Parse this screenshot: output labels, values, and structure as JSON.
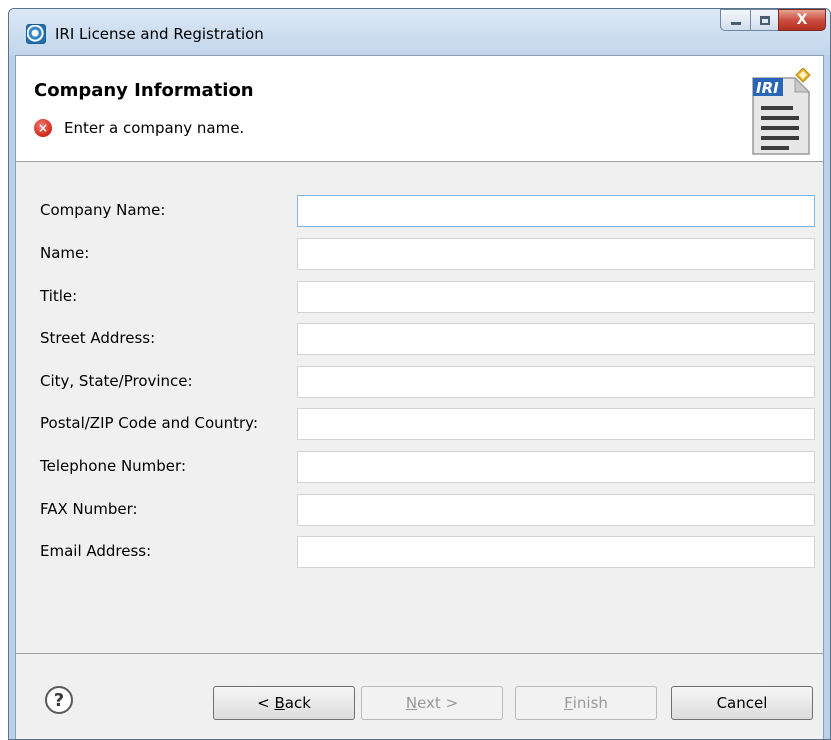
{
  "window": {
    "title": "IRI License and Registration",
    "minimize_glyph": "",
    "maximize_glyph": "",
    "close_glyph": "X"
  },
  "banner": {
    "title": "Company Information",
    "error_message": "Enter a company name.",
    "error_icon_glyph": "×",
    "logo_text": "IRI"
  },
  "form": {
    "fields": [
      {
        "label": "Company Name:",
        "value": ""
      },
      {
        "label": "Name:",
        "value": ""
      },
      {
        "label": "Title:",
        "value": ""
      },
      {
        "label": "Street Address:",
        "value": ""
      },
      {
        "label": "City, State/Province:",
        "value": ""
      },
      {
        "label": "Postal/ZIP Code and Country:",
        "value": ""
      },
      {
        "label": "Telephone Number:",
        "value": ""
      },
      {
        "label": "FAX Number:",
        "value": ""
      },
      {
        "label": "Email Address:",
        "value": ""
      }
    ]
  },
  "footer": {
    "help_glyph": "?",
    "back": {
      "mnemonic": "B",
      "rest": "ack",
      "prefix": "< "
    },
    "next": {
      "mnemonic": "N",
      "rest": "ext >"
    },
    "finish": {
      "mnemonic": "F",
      "rest": "inish"
    },
    "cancel": "Cancel"
  },
  "colors": {
    "error": "#d2281c",
    "focus_border": "#7eb4ea",
    "titlebar": "#c2d6ec",
    "disabled_text": "#9a9a9a"
  }
}
